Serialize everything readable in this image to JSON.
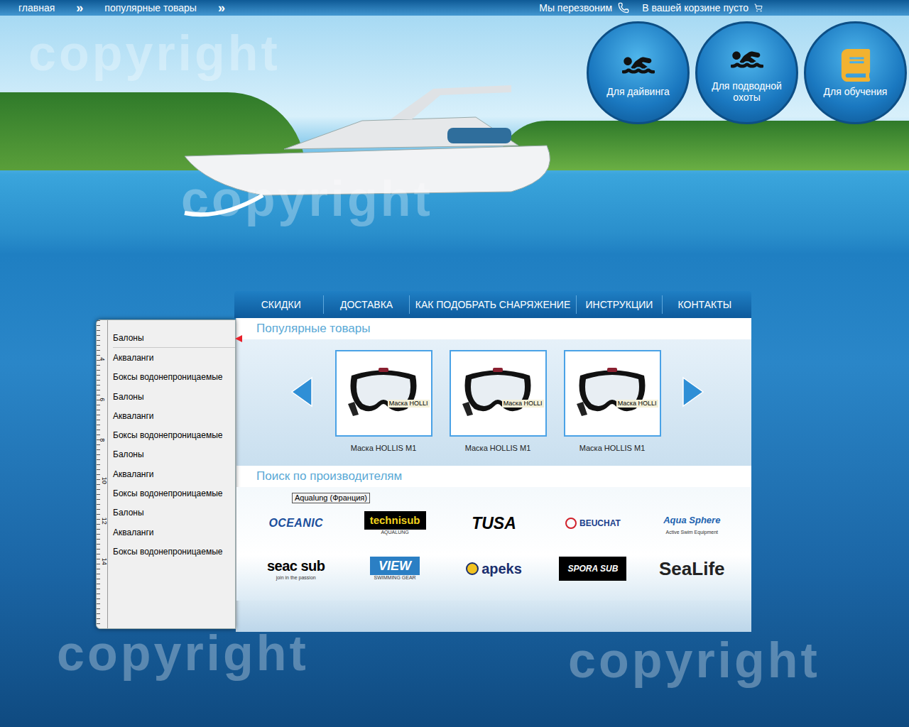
{
  "topbar": {
    "breadcrumbs": [
      {
        "label": "главная"
      },
      {
        "label": "популярные товары"
      }
    ],
    "separator": "»",
    "callback": "Мы перезвоним",
    "cart": "В вашей корзине пусто"
  },
  "categories": [
    {
      "label": "Для дайвинга"
    },
    {
      "label": "Для подводной охоты"
    },
    {
      "label": "Для обучения"
    }
  ],
  "nav": [
    {
      "label": "СКИДКИ"
    },
    {
      "label": "ДОСТАВКА"
    },
    {
      "label": "КАК ПОДОБРАТЬ СНАРЯЖЕНИЕ"
    },
    {
      "label": "ИНСТРУКЦИИ"
    },
    {
      "label": "КОНТАКТЫ"
    }
  ],
  "sidebar": {
    "ruler": [
      "4",
      "6",
      "8",
      "10",
      "12",
      "14"
    ],
    "items": [
      {
        "label": "Балоны",
        "selected": true
      },
      {
        "label": "Акваланги",
        "selected": false
      },
      {
        "label": "Боксы водонепроницаемые",
        "selected": false
      },
      {
        "label": "Балоны",
        "selected": false
      },
      {
        "label": "Акваланги",
        "selected": false
      },
      {
        "label": "Боксы водонепроницаемые",
        "selected": false
      },
      {
        "label": "Балоны",
        "selected": false
      },
      {
        "label": "Акваланги",
        "selected": false
      },
      {
        "label": "Боксы водонепроницаемые",
        "selected": false
      },
      {
        "label": "Балоны",
        "selected": false
      },
      {
        "label": "Акваланги",
        "selected": false
      },
      {
        "label": "Боксы водонепроницаемые",
        "selected": false
      }
    ]
  },
  "popular": {
    "title": "Популярные товары",
    "cards": [
      {
        "badge": "Маска HOLLI",
        "caption": "Маска HOLLIS M1"
      },
      {
        "badge": "Маска HOLLI",
        "caption": "Маска HOLLIS M1"
      },
      {
        "badge": "Маска HOLLI",
        "caption": "Маска HOLLIS M1"
      }
    ]
  },
  "brands": {
    "title": "Поиск по производителям",
    "tooltip": "Aqualung (Франция)",
    "items": [
      {
        "name": "OCEANIC"
      },
      {
        "name": "technisub",
        "sub": "AQUALUNG"
      },
      {
        "name": "TUSA"
      },
      {
        "name": "BEUCHAT"
      },
      {
        "name": "Aqua Sphere",
        "sub": "Active Swim Equipment"
      },
      {
        "name": "seac sub",
        "sub": "join in the passion"
      },
      {
        "name": "VIEW",
        "sub": "SWIMMING GEAR"
      },
      {
        "name": "apeks"
      },
      {
        "name": "SPORA SUB"
      },
      {
        "name": "SeaLife"
      }
    ]
  },
  "watermarks": [
    "copyright",
    "copyright",
    "copyright",
    "copyright"
  ]
}
